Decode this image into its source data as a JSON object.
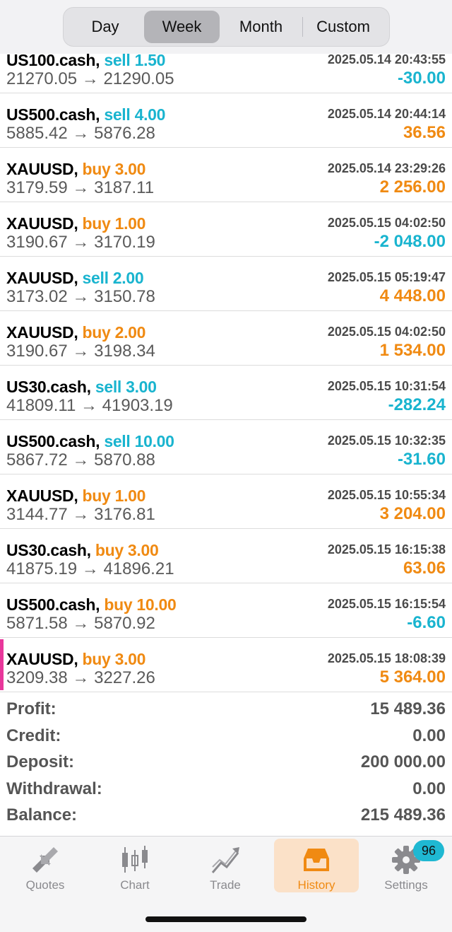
{
  "period_tabs": [
    {
      "label": "Day",
      "active": false
    },
    {
      "label": "Week",
      "active": true
    },
    {
      "label": "Month",
      "active": false
    },
    {
      "label": "Custom",
      "active": false
    }
  ],
  "trades": [
    {
      "symbol": "US100.cash,",
      "side": "sell",
      "volume": "sell 1.50",
      "time": "2025.05.14 20:43:55",
      "prices": "21270.05 → 21290.05",
      "profit": "-30.00",
      "profit_sign": "neg"
    },
    {
      "symbol": "US500.cash,",
      "side": "sell",
      "volume": "sell 4.00",
      "time": "2025.05.14 20:44:14",
      "prices": "5885.42 → 5876.28",
      "profit": "36.56",
      "profit_sign": "pos"
    },
    {
      "symbol": "XAUUSD,",
      "side": "buy",
      "volume": "buy 3.00",
      "time": "2025.05.14 23:29:26",
      "prices": "3179.59 → 3187.11",
      "profit": "2 256.00",
      "profit_sign": "pos"
    },
    {
      "symbol": "XAUUSD,",
      "side": "buy",
      "volume": "buy 1.00",
      "time": "2025.05.15 04:02:50",
      "prices": "3190.67 → 3170.19",
      "profit": "-2 048.00",
      "profit_sign": "neg"
    },
    {
      "symbol": "XAUUSD,",
      "side": "sell",
      "volume": "sell 2.00",
      "time": "2025.05.15 05:19:47",
      "prices": "3173.02 → 3150.78",
      "profit": "4 448.00",
      "profit_sign": "pos"
    },
    {
      "symbol": "XAUUSD,",
      "side": "buy",
      "volume": "buy 2.00",
      "time": "2025.05.15 04:02:50",
      "prices": "3190.67 → 3198.34",
      "profit": "1 534.00",
      "profit_sign": "pos"
    },
    {
      "symbol": "US30.cash,",
      "side": "sell",
      "volume": "sell 3.00",
      "time": "2025.05.15 10:31:54",
      "prices": "41809.11 → 41903.19",
      "profit": "-282.24",
      "profit_sign": "neg"
    },
    {
      "symbol": "US500.cash,",
      "side": "sell",
      "volume": "sell 10.00",
      "time": "2025.05.15 10:32:35",
      "prices": "5867.72 → 5870.88",
      "profit": "-31.60",
      "profit_sign": "neg"
    },
    {
      "symbol": "XAUUSD,",
      "side": "buy",
      "volume": "buy 1.00",
      "time": "2025.05.15 10:55:34",
      "prices": "3144.77 → 3176.81",
      "profit": "3 204.00",
      "profit_sign": "pos"
    },
    {
      "symbol": "US30.cash,",
      "side": "buy",
      "volume": "buy 3.00",
      "time": "2025.05.15 16:15:38",
      "prices": "41875.19 → 41896.21",
      "profit": "63.06",
      "profit_sign": "pos"
    },
    {
      "symbol": "US500.cash,",
      "side": "buy",
      "volume": "buy 10.00",
      "time": "2025.05.15 16:15:54",
      "prices": "5871.58 → 5870.92",
      "profit": "-6.60",
      "profit_sign": "neg"
    },
    {
      "symbol": "XAUUSD,",
      "side": "buy",
      "volume": "buy 3.00",
      "time": "2025.05.15 18:08:39",
      "prices": "3209.38 → 3227.26",
      "profit": "5 364.00",
      "profit_sign": "pos",
      "marked": true
    }
  ],
  "summary": [
    {
      "label": "Profit:",
      "value": "15 489.36"
    },
    {
      "label": "Credit:",
      "value": "0.00"
    },
    {
      "label": "Deposit:",
      "value": "200 000.00"
    },
    {
      "label": "Withdrawal:",
      "value": "0.00"
    },
    {
      "label": "Balance:",
      "value": "215 489.36"
    }
  ],
  "tabbar": [
    {
      "label": "Quotes",
      "icon": "quotes-arrows-icon",
      "active": false
    },
    {
      "label": "Chart",
      "icon": "candlestick-chart-icon",
      "active": false
    },
    {
      "label": "Trade",
      "icon": "trade-trend-icon",
      "active": false
    },
    {
      "label": "History",
      "icon": "inbox-tray-icon",
      "active": true
    },
    {
      "label": "Settings",
      "icon": "gear-icon",
      "active": false
    }
  ],
  "settings_badge": "96",
  "colors": {
    "sell": "#19b4cf",
    "buy": "#f08a12",
    "marker": "#e8379b",
    "active_tab_bg": "#fbe1c8"
  }
}
